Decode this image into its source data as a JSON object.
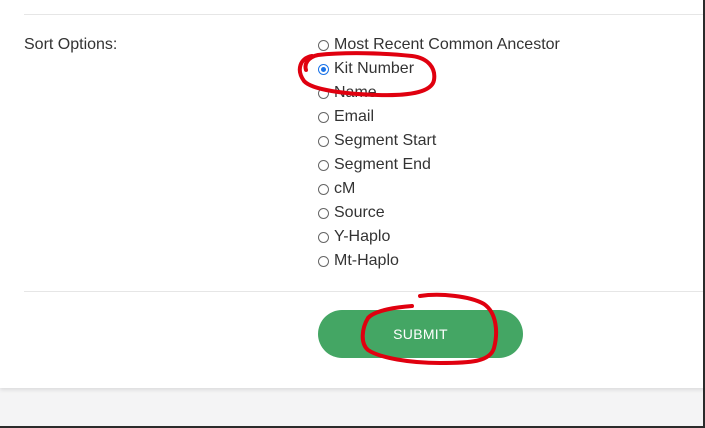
{
  "form": {
    "sort_label": "Sort Options:",
    "sort_options": [
      {
        "label": "Most Recent Common Ancestor",
        "checked": false
      },
      {
        "label": "Kit Number",
        "checked": true
      },
      {
        "label": "Name",
        "checked": false
      },
      {
        "label": "Email",
        "checked": false
      },
      {
        "label": "Segment Start",
        "checked": false
      },
      {
        "label": "Segment End",
        "checked": false
      },
      {
        "label": "cM",
        "checked": false
      },
      {
        "label": "Source",
        "checked": false
      },
      {
        "label": "Y-Haplo",
        "checked": false
      },
      {
        "label": "Mt-Haplo",
        "checked": false
      }
    ],
    "selected_option": "Kit Number",
    "submit_label": "SUBMIT"
  },
  "colors": {
    "submit_bg": "#44a664",
    "annotation": "#e0000f",
    "radio_selected": "#1a73e8"
  }
}
